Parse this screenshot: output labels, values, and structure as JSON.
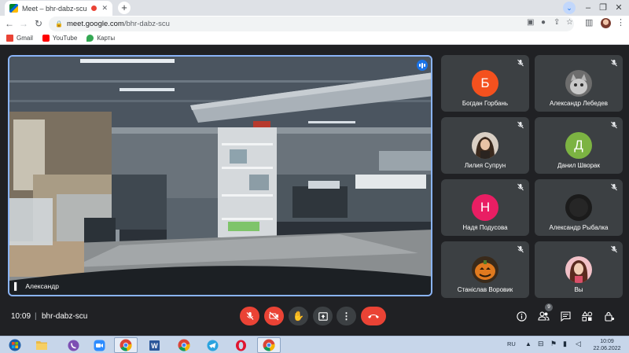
{
  "browser": {
    "tab": {
      "title": "Meet – bhr-dabz-scu"
    },
    "url": {
      "host": "meet.google.com",
      "path": "/bhr-dabz-scu"
    },
    "bookmarks": [
      {
        "label": "Gmail",
        "color": "#ea4335"
      },
      {
        "label": "YouTube",
        "color": "#ff0000"
      },
      {
        "label": "Карты",
        "color": "#34a853"
      }
    ]
  },
  "meeting": {
    "main_speaker": {
      "name": "Александр"
    },
    "participants": [
      {
        "name": "Богдан Горбань",
        "initial": "Б",
        "avatar_color": "#f4511e",
        "avatar": "letter"
      },
      {
        "name": "Александр Лебедев",
        "initial": "",
        "avatar_color": "#6d6d6d",
        "avatar": "photo-cat"
      },
      {
        "name": "Лилия Супрун",
        "initial": "",
        "avatar_color": "#4a3a2c",
        "avatar": "photo-woman"
      },
      {
        "name": "Данил Шворак",
        "initial": "Д",
        "avatar_color": "#7cb342",
        "avatar": "letter"
      },
      {
        "name": "Надя Подусова",
        "initial": "Н",
        "avatar_color": "#e91e63",
        "avatar": "letter"
      },
      {
        "name": "Александр Рыбалка",
        "initial": "",
        "avatar_color": "#1b1b1b",
        "avatar": "photo-dark"
      },
      {
        "name": "Станіслав Воровик",
        "initial": "",
        "avatar_color": "#e07a1f",
        "avatar": "photo-pumpkin"
      },
      {
        "name": "Вы",
        "initial": "",
        "avatar_color": "#f2c1c8",
        "avatar": "photo-self"
      }
    ],
    "time": "10:09",
    "separator": "|",
    "code": "bhr-dabz-scu",
    "participant_count": "9"
  },
  "taskbar": {
    "language": "RU",
    "clock_time": "10:09",
    "clock_date": "22.06.2022"
  }
}
